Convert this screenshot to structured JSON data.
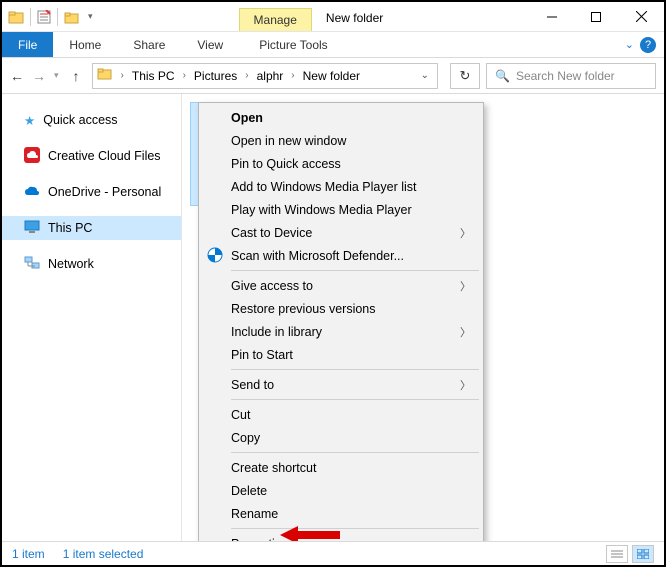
{
  "window": {
    "title": "New folder",
    "contextual_tab": "Manage",
    "contextual_group": "Picture Tools"
  },
  "ribbon": {
    "file": "File",
    "tabs": [
      "Home",
      "Share",
      "View"
    ]
  },
  "nav": {
    "crumbs": [
      "This PC",
      "Pictures",
      "alphr",
      "New folder"
    ]
  },
  "search": {
    "placeholder": "Search New folder"
  },
  "sidebar": {
    "items": [
      {
        "label": "Quick access"
      },
      {
        "label": "Creative Cloud Files"
      },
      {
        "label": "OneDrive - Personal"
      },
      {
        "label": "This PC"
      },
      {
        "label": "Network"
      }
    ]
  },
  "context_menu": {
    "items": [
      {
        "label": "Open",
        "bold": true
      },
      {
        "label": "Open in new window"
      },
      {
        "label": "Pin to Quick access"
      },
      {
        "label": "Add to Windows Media Player list"
      },
      {
        "label": "Play with Windows Media Player"
      },
      {
        "label": "Cast to Device",
        "submenu": true
      },
      {
        "label": "Scan with Microsoft Defender...",
        "icon": "defender"
      },
      {
        "sep": true
      },
      {
        "label": "Give access to",
        "submenu": true
      },
      {
        "label": "Restore previous versions"
      },
      {
        "label": "Include in library",
        "submenu": true
      },
      {
        "label": "Pin to Start"
      },
      {
        "sep": true
      },
      {
        "label": "Send to",
        "submenu": true
      },
      {
        "sep": true
      },
      {
        "label": "Cut"
      },
      {
        "label": "Copy"
      },
      {
        "sep": true
      },
      {
        "label": "Create shortcut"
      },
      {
        "label": "Delete"
      },
      {
        "label": "Rename"
      },
      {
        "sep": true
      },
      {
        "label": "Properties"
      }
    ]
  },
  "status": {
    "count": "1 item",
    "selected": "1 item selected"
  }
}
